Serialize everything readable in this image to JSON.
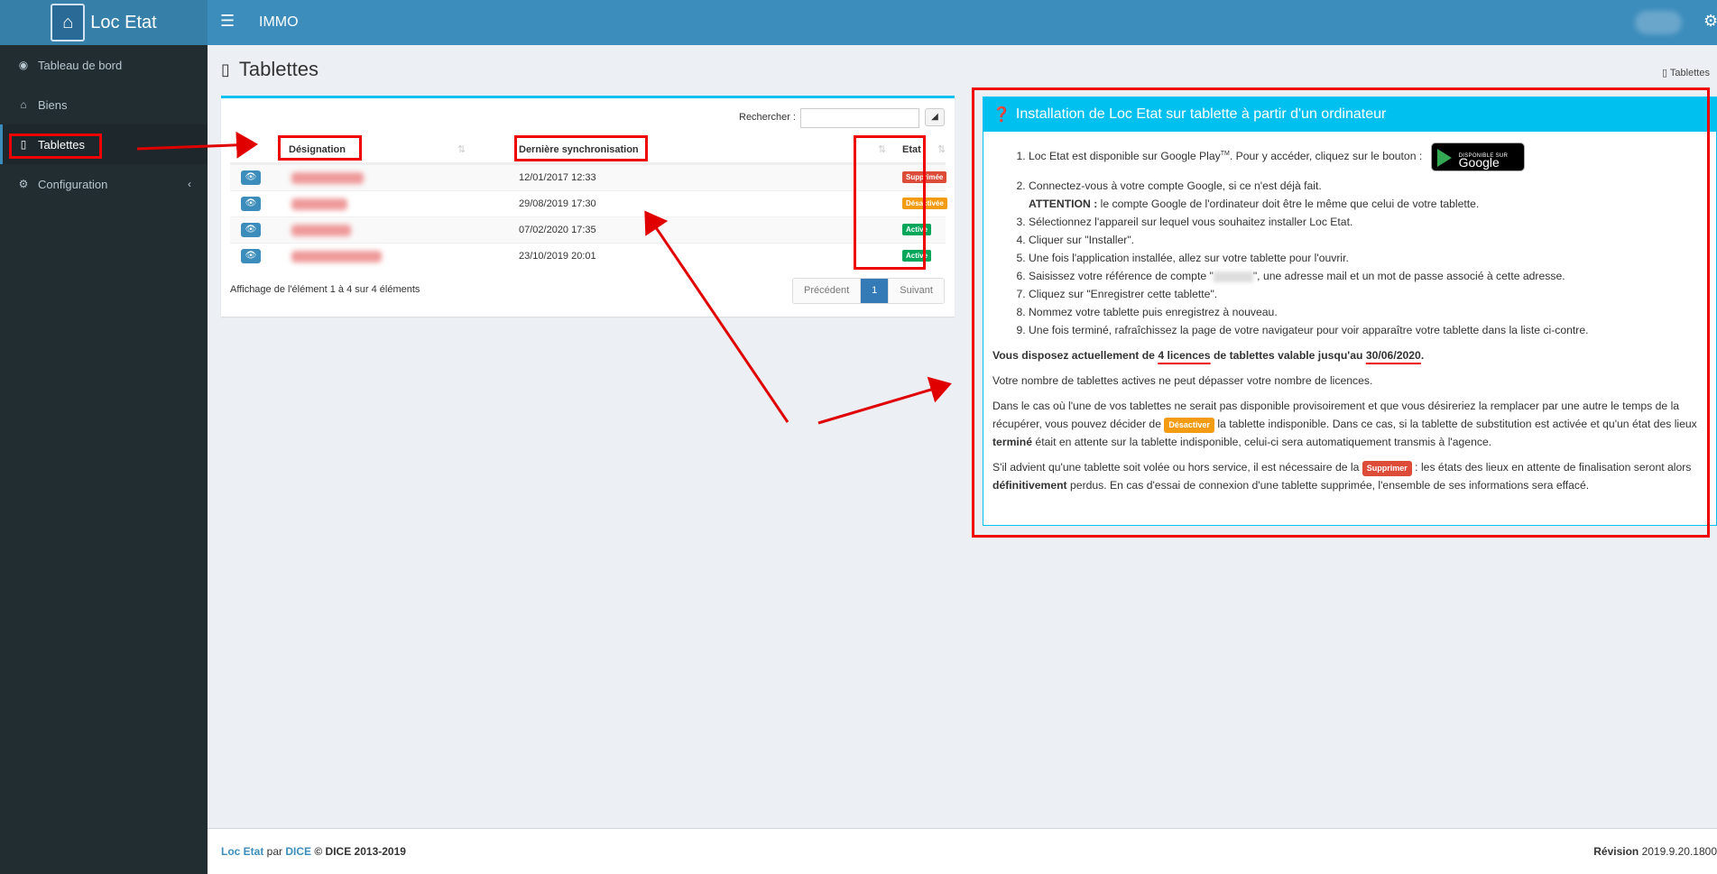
{
  "header": {
    "brand": "Loc Etat",
    "app_name": "IMMO",
    "menu_icon": "hamburger-icon",
    "settings_icon": "gears-icon"
  },
  "sidebar": {
    "items": [
      {
        "label": "Tableau de bord",
        "icon": "dashboard-icon"
      },
      {
        "label": "Biens",
        "icon": "home-icon"
      },
      {
        "label": "Tablettes",
        "icon": "tablet-icon",
        "active": true
      },
      {
        "label": "Configuration",
        "icon": "cogs-icon",
        "chevron": "‹"
      }
    ]
  },
  "page": {
    "title": "Tablettes",
    "breadcrumb": "Tablettes"
  },
  "table": {
    "search_label": "Rechercher :",
    "search_value": "",
    "columns": [
      "Désignation",
      "Dernière synchronisation",
      "Etat"
    ],
    "rows": [
      {
        "name": "",
        "date": "12/01/2017 12:33",
        "status": "Supprimée",
        "status_color": "#dd4b39"
      },
      {
        "name": "",
        "date": "29/08/2019 17:30",
        "status": "Désactivée",
        "status_color": "#f39c12"
      },
      {
        "name": "",
        "date": "07/02/2020 17:35",
        "status": "Active",
        "status_color": "#00a65a"
      },
      {
        "name": "",
        "date": "23/10/2019 20:01",
        "status": "Active",
        "status_color": "#00a65a"
      }
    ],
    "info": "Affichage de l'élément 1 à 4 sur 4 éléments",
    "pager": {
      "prev": "Précédent",
      "current": "1",
      "next": "Suivant"
    }
  },
  "install": {
    "title": "Installation de Loc Etat sur tablette à partir d'un ordinateur",
    "step1": "Loc Etat est disponible sur Google Play",
    "step1_tm": "TM",
    "step1_end": ". Pour y accéder, cliquez sur le bouton :",
    "gp_small": "DISPONIBLE SUR",
    "gp_big": "Google Play",
    "step2": "Connectez-vous à votre compte Google, si ce n'est déjà fait.",
    "step2_attention": "ATTENTION :",
    "step2_note": " le compte Google de l'ordinateur doit être le même que celui de votre tablette.",
    "step3": "Sélectionnez l'appareil sur lequel vous souhaitez installer Loc Etat.",
    "step4": "Cliquer sur \"Installer\".",
    "step5": "Une fois l'application installée, allez sur votre tablette pour l'ouvrir.",
    "step6a": "Saisissez votre référence de compte \"",
    "step6b": "\", une adresse mail et un mot de passe associé à cette adresse.",
    "step7": "Cliquez sur \"Enregistrer cette tablette\".",
    "step8": "Nommez votre tablette puis enregistrez à nouveau.",
    "step9": "Une fois terminé, rafraîchissez la page de votre navigateur pour voir apparaître votre tablette dans la liste ci-contre.",
    "lic_a": "Vous disposez actuellement de ",
    "lic_count": "4 licences",
    "lic_b": " de tablettes valable jusqu'au ",
    "lic_date": "30/06/2020",
    "lic_c": ".",
    "p_limit": "Votre nombre de tablettes actives ne peut dépasser votre nombre de licences.",
    "p_case_a": "Dans le cas où l'une de vos tablettes ne serait pas disponible provisoirement et que vous désireriez la remplacer par une autre le temps de la récupérer, vous pouvez décider de ",
    "lbl_desactiver": "Désactiver",
    "p_case_b": " la tablette indisponible. Dans ce cas, si la tablette de substitution est activée et qu'un état des lieux ",
    "p_case_bold": "terminé",
    "p_case_c": " était en attente sur la tablette indisponible, celui-ci sera automatiquement transmis à l'agence.",
    "p_stolen_a": "S'il advient qu'une tablette soit volée ou hors service, il est nécessaire de la ",
    "lbl_supprimer": "Supprimer",
    "p_stolen_b": " : les états des lieux en attente de finalisation seront alors ",
    "p_stolen_bold": "définitivement",
    "p_stolen_c": " perdus. En cas d'essai de connexion d'une tablette supprimée, l'ensemble de ses informations sera effacé."
  },
  "footer": {
    "brand": "Loc Etat",
    "par": " par ",
    "company": "DICE",
    "copyright": " © DICE 2013-2019",
    "revision_label": "Révision",
    "revision_value": " 2019.9.20.1800"
  },
  "colors": {
    "header": "#3c8dbc",
    "sidebar": "#222d32",
    "info_box": "#00c0ef",
    "annotation": "#e00000"
  }
}
